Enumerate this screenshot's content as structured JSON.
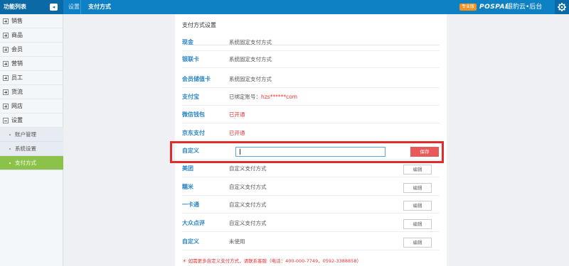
{
  "topbar": {
    "function_list_title": "功能列表",
    "toggle_icon": "collapse-icon",
    "breadcrumb_parent": "设置",
    "breadcrumb_current": "支付方式",
    "edition_badge": "专业版",
    "brand_logo": "POSPAL",
    "brand_name": "银豹云•后台",
    "settings_icon": "gear-icon",
    "color_primary": "#0e80c4",
    "color_dark": "#0b6aa5"
  },
  "sidebar": {
    "items": [
      {
        "label": "销售"
      },
      {
        "label": "商品"
      },
      {
        "label": "会员"
      },
      {
        "label": "营销"
      },
      {
        "label": "员工"
      },
      {
        "label": "货流"
      },
      {
        "label": "网店"
      },
      {
        "label": "设置"
      }
    ],
    "sub_items": [
      {
        "label": "账户管理"
      },
      {
        "label": "系统设置"
      },
      {
        "label": "支付方式"
      }
    ],
    "active_color": "#8bc34a"
  },
  "panel": {
    "title": "支付方式设置",
    "rows": [
      {
        "name": "现金",
        "value": "系统固定支付方式"
      },
      {
        "name": "银联卡",
        "value": "系统固定支付方式"
      },
      {
        "name": "会员储值卡",
        "value": "系统固定支付方式"
      },
      {
        "name": "支付宝",
        "value": "已绑定账号：",
        "account": "hzs******com"
      },
      {
        "name": "微信钱包",
        "value": "已开通"
      },
      {
        "name": "京东支付",
        "value": "已开通"
      }
    ],
    "custom_row": {
      "name": "自定义",
      "input_value": "",
      "save_label": "保存"
    },
    "editable_rows": [
      {
        "name": "美团",
        "value": "自定义支付方式",
        "button": "编辑"
      },
      {
        "name": "糯米",
        "value": "自定义支付方式",
        "button": "编辑"
      },
      {
        "name": "一卡通",
        "value": "自定义支付方式",
        "button": "编辑"
      },
      {
        "name": "大众点评",
        "value": "自定义支付方式",
        "button": "编辑"
      },
      {
        "name": "自定义",
        "value": "未使用",
        "button": "编辑"
      }
    ],
    "footnote": "＊ 如需更多自定义支付方式，请联系客服（电话：400-000-7749，0592-3388858）"
  }
}
